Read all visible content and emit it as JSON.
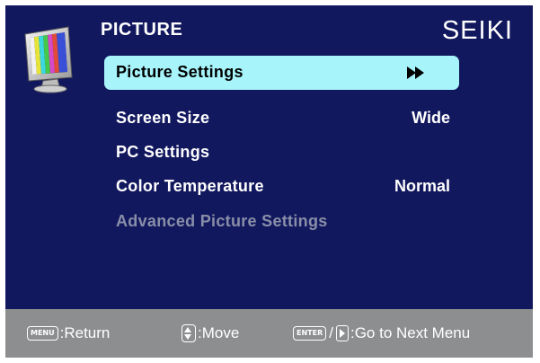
{
  "header": {
    "title": "PICTURE",
    "brand": "SEIKI",
    "icon": "monitor-color-bars-icon"
  },
  "menu": {
    "items": [
      {
        "label": "Picture Settings",
        "value": "",
        "selected": true,
        "enabled": true,
        "icon": "fast-forward-icon"
      },
      {
        "label": "Screen Size",
        "value": "Wide",
        "selected": false,
        "enabled": true
      },
      {
        "label": "PC Settings",
        "value": "",
        "selected": false,
        "enabled": true
      },
      {
        "label": "Color Temperature",
        "value": "Normal",
        "selected": false,
        "enabled": true
      },
      {
        "label": "Advanced Picture Settings",
        "value": "",
        "selected": false,
        "enabled": false
      }
    ]
  },
  "footer": {
    "return_key": "MENU",
    "return_label": ":Return",
    "move_label": ":Move",
    "enter_key": "ENTER",
    "slash": "/",
    "next_label": ":Go to Next Menu"
  },
  "colors": {
    "panel": "#12185e",
    "highlight": "#a7f4fb",
    "footer": "#8c8e90",
    "disabled_text": "#898ea8"
  }
}
